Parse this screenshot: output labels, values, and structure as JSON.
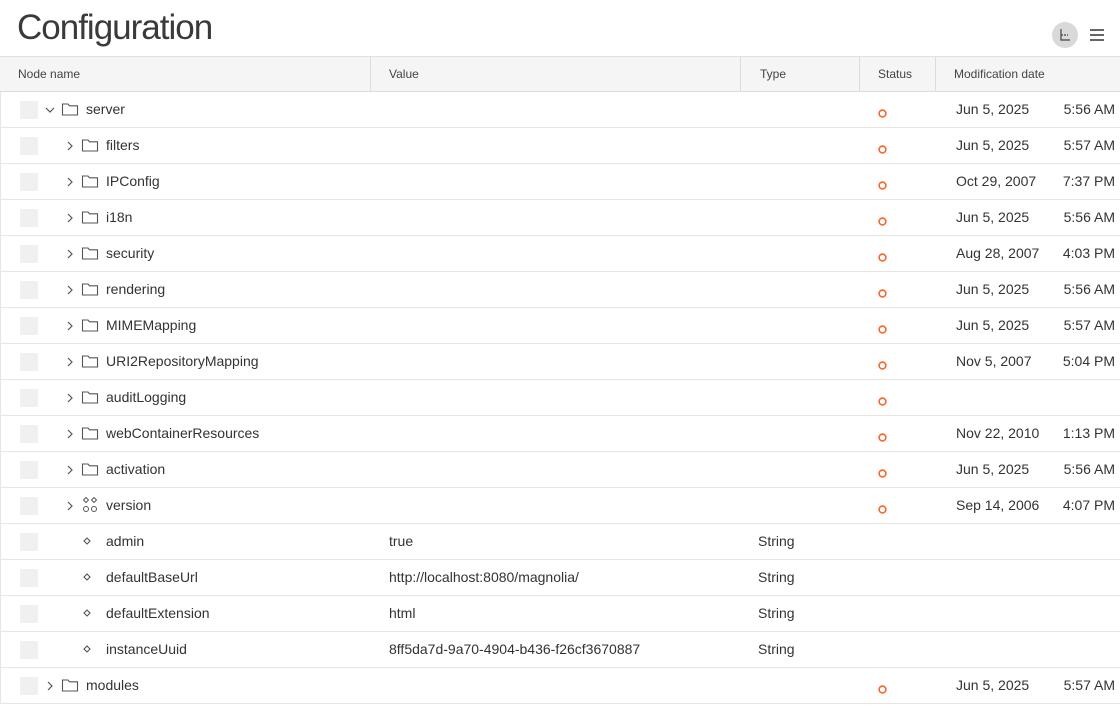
{
  "app": {
    "title": "Configuration"
  },
  "columns": [
    "Node name",
    "Value",
    "Type",
    "Status",
    "Modification date"
  ],
  "rows": [
    {
      "name": "server",
      "level": 0,
      "kind": "folder",
      "expanded": true,
      "value": "",
      "type": "",
      "status": true,
      "date": "Jun 5, 2025",
      "time": "5:56 AM"
    },
    {
      "name": "filters",
      "level": 1,
      "kind": "folder",
      "expanded": false,
      "value": "",
      "type": "",
      "status": true,
      "date": "Jun 5, 2025",
      "time": "5:57 AM"
    },
    {
      "name": "IPConfig",
      "level": 1,
      "kind": "folder",
      "expanded": false,
      "value": "",
      "type": "",
      "status": true,
      "date": "Oct 29, 2007",
      "time": "7:37 PM"
    },
    {
      "name": "i18n",
      "level": 1,
      "kind": "folder",
      "expanded": false,
      "value": "",
      "type": "",
      "status": true,
      "date": "Jun 5, 2025",
      "time": "5:56 AM"
    },
    {
      "name": "security",
      "level": 1,
      "kind": "folder",
      "expanded": false,
      "value": "",
      "type": "",
      "status": true,
      "date": "Aug 28, 2007",
      "time": "4:03 PM"
    },
    {
      "name": "rendering",
      "level": 1,
      "kind": "folder",
      "expanded": false,
      "value": "",
      "type": "",
      "status": true,
      "date": "Jun 5, 2025",
      "time": "5:56 AM"
    },
    {
      "name": "MIMEMapping",
      "level": 1,
      "kind": "folder",
      "expanded": false,
      "value": "",
      "type": "",
      "status": true,
      "date": "Jun 5, 2025",
      "time": "5:57 AM"
    },
    {
      "name": "URI2RepositoryMapping",
      "level": 1,
      "kind": "folder",
      "expanded": false,
      "value": "",
      "type": "",
      "status": true,
      "date": "Nov 5, 2007",
      "time": "5:04 PM"
    },
    {
      "name": "auditLogging",
      "level": 1,
      "kind": "folder",
      "expanded": false,
      "value": "",
      "type": "",
      "status": true,
      "date": "",
      "time": ""
    },
    {
      "name": "webContainerResources",
      "level": 1,
      "kind": "folder",
      "expanded": false,
      "value": "",
      "type": "",
      "status": true,
      "date": "Nov 22, 2010",
      "time": "1:13 PM"
    },
    {
      "name": "activation",
      "level": 1,
      "kind": "folder",
      "expanded": false,
      "value": "",
      "type": "",
      "status": true,
      "date": "Jun 5, 2025",
      "time": "5:56 AM"
    },
    {
      "name": "version",
      "level": 1,
      "kind": "content",
      "expanded": false,
      "value": "",
      "type": "",
      "status": true,
      "date": "Sep 14, 2006",
      "time": "4:07 PM"
    },
    {
      "name": "admin",
      "level": 1,
      "kind": "property",
      "value": "true",
      "type": "String",
      "status": false,
      "date": "",
      "time": ""
    },
    {
      "name": "defaultBaseUrl",
      "level": 1,
      "kind": "property",
      "value": "http://localhost:8080/magnolia/",
      "type": "String",
      "status": false,
      "date": "",
      "time": ""
    },
    {
      "name": "defaultExtension",
      "level": 1,
      "kind": "property",
      "value": "html",
      "type": "String",
      "status": false,
      "date": "",
      "time": ""
    },
    {
      "name": "instanceUuid",
      "level": 1,
      "kind": "property",
      "value": "8ff5da7d-9a70-4904-b436-f26cf3670887",
      "type": "String",
      "status": false,
      "date": "",
      "time": ""
    },
    {
      "name": "modules",
      "level": 0,
      "kind": "folder",
      "expanded": false,
      "value": "",
      "type": "",
      "status": true,
      "date": "Jun 5, 2025",
      "time": "5:57 AM"
    }
  ],
  "colors": {
    "status_accent": "#f26a2b",
    "icon": "#555555",
    "header_bg": "#f5f5f5"
  }
}
